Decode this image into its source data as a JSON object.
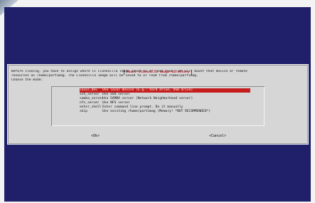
{
  "dialog": {
    "title": "Mount clonezilla image directory",
    "intro_lines": [
      "Before cloning, you have to assign where is Clonezilla image saved to or read from ? We will mount that device or remote",
      "resources as /home/partimag. The Clonezilla image will be saved to or read from /home/partimag.",
      "Choose the mode:"
    ],
    "menu_items": [
      {
        "key": "local_dev",
        "desc": "Use local device (E.g.: hard drive, USB drive)",
        "selected": true
      },
      {
        "key": "ssh_server",
        "desc": "Use SSH server",
        "selected": false
      },
      {
        "key": "samba_server",
        "desc": "Use SAMBA server (Network Neighborhood server)",
        "selected": false
      },
      {
        "key": "nfs_server",
        "desc": "Use NFS server",
        "selected": false
      },
      {
        "key": "enter_shell",
        "desc": "Enter command line prompt. Do it manually",
        "selected": false
      },
      {
        "key": "skip",
        "desc": "Use existing /home/partimag (Memory! *NOT RECOMMENDED*)",
        "selected": false
      }
    ],
    "ok_label": "<Ok>",
    "cancel_label": "<Cancel>"
  },
  "colors": {
    "screen_background": "#20206a",
    "dialog_background": "#d6d6d6",
    "selection_background": "#c51d1d",
    "title_text": "#c8202a"
  }
}
